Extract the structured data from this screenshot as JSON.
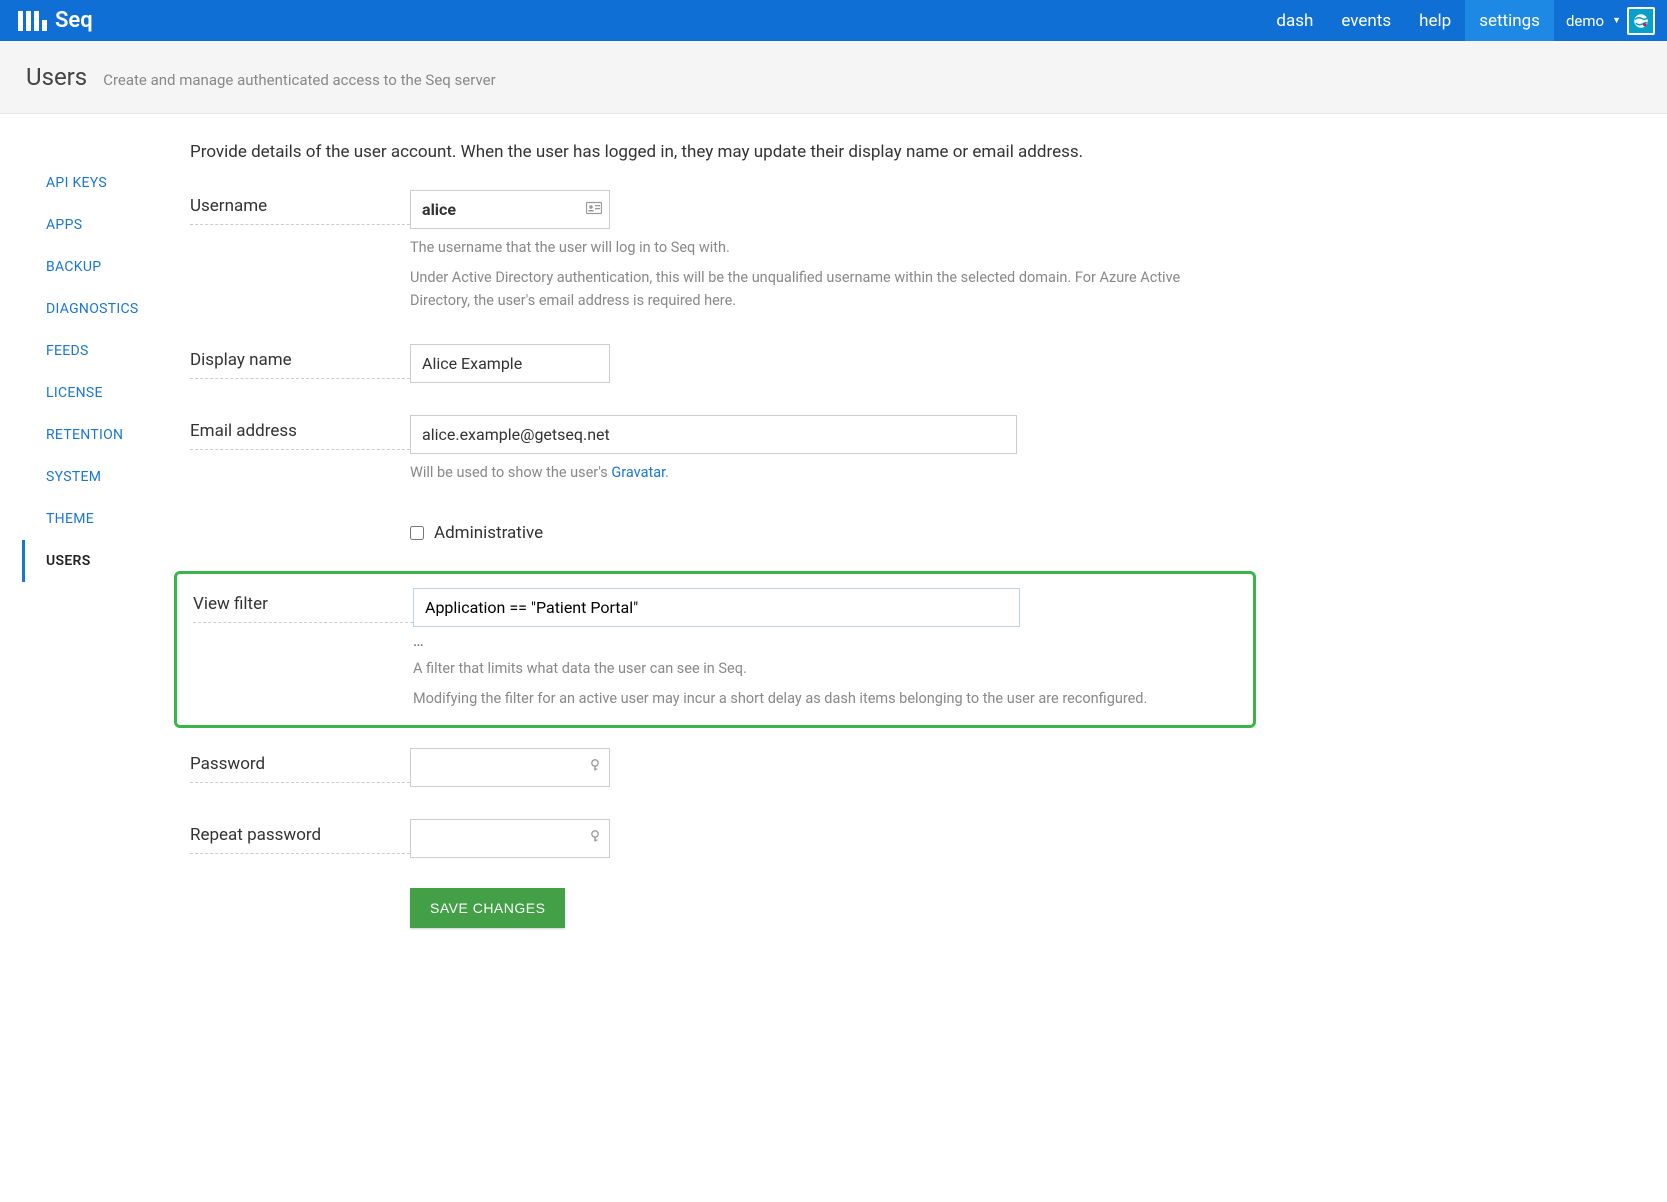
{
  "brand": "Seq",
  "nav": {
    "items": [
      {
        "label": "dash"
      },
      {
        "label": "events"
      },
      {
        "label": "help"
      },
      {
        "label": "settings",
        "active": true
      }
    ],
    "user": {
      "label": "demo"
    }
  },
  "header": {
    "title": "Users",
    "subtitle": "Create and manage authenticated access to the Seq server"
  },
  "sidebar": {
    "items": [
      {
        "label": "API KEYS"
      },
      {
        "label": "APPS"
      },
      {
        "label": "BACKUP"
      },
      {
        "label": "DIAGNOSTICS"
      },
      {
        "label": "FEEDS"
      },
      {
        "label": "LICENSE"
      },
      {
        "label": "RETENTION"
      },
      {
        "label": "SYSTEM"
      },
      {
        "label": "THEME"
      },
      {
        "label": "USERS",
        "active": true
      }
    ]
  },
  "intro": "Provide details of the user account. When the user has logged in, they may update their display name or email address.",
  "form": {
    "username": {
      "label": "Username",
      "value": "alice",
      "help1": "The username that the user will log in to Seq with.",
      "help2": "Under Active Directory authentication, this will be the unqualified username within the selected domain. For Azure Active Directory, the user's email address is required here."
    },
    "display_name": {
      "label": "Display name",
      "value": "Alice Example"
    },
    "email": {
      "label": "Email address",
      "value": "alice.example@getseq.net",
      "help_prefix": "Will be used to show the user's ",
      "help_link": "Gravatar",
      "help_suffix": "."
    },
    "administrative": {
      "label": "Administrative",
      "checked": false
    },
    "view_filter": {
      "label": "View filter",
      "value": "Application == \"Patient Portal\"",
      "ellipsis": "…",
      "help1": "A filter that limits what data the user can see in Seq.",
      "help2": "Modifying the filter for an active user may incur a short delay as dash items belonging to the user are reconfigured."
    },
    "password": {
      "label": "Password",
      "value": ""
    },
    "repeat_password": {
      "label": "Repeat password",
      "value": ""
    },
    "save": "SAVE CHANGES"
  }
}
